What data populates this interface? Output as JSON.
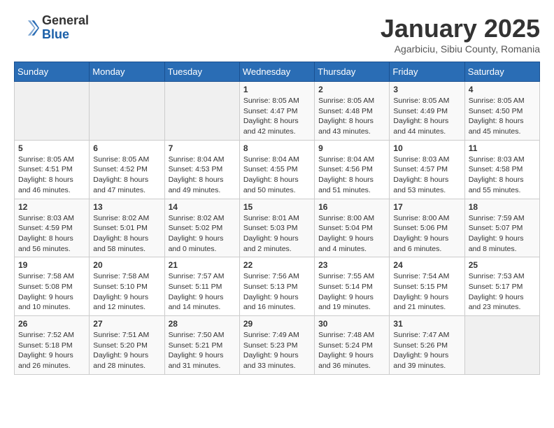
{
  "header": {
    "logo_general": "General",
    "logo_blue": "Blue",
    "month_title": "January 2025",
    "location": "Agarbiciu, Sibiu County, Romania"
  },
  "days_of_week": [
    "Sunday",
    "Monday",
    "Tuesday",
    "Wednesday",
    "Thursday",
    "Friday",
    "Saturday"
  ],
  "weeks": [
    [
      {
        "day": "",
        "info": ""
      },
      {
        "day": "",
        "info": ""
      },
      {
        "day": "",
        "info": ""
      },
      {
        "day": "1",
        "info": "Sunrise: 8:05 AM\nSunset: 4:47 PM\nDaylight: 8 hours and 42 minutes."
      },
      {
        "day": "2",
        "info": "Sunrise: 8:05 AM\nSunset: 4:48 PM\nDaylight: 8 hours and 43 minutes."
      },
      {
        "day": "3",
        "info": "Sunrise: 8:05 AM\nSunset: 4:49 PM\nDaylight: 8 hours and 44 minutes."
      },
      {
        "day": "4",
        "info": "Sunrise: 8:05 AM\nSunset: 4:50 PM\nDaylight: 8 hours and 45 minutes."
      }
    ],
    [
      {
        "day": "5",
        "info": "Sunrise: 8:05 AM\nSunset: 4:51 PM\nDaylight: 8 hours and 46 minutes."
      },
      {
        "day": "6",
        "info": "Sunrise: 8:05 AM\nSunset: 4:52 PM\nDaylight: 8 hours and 47 minutes."
      },
      {
        "day": "7",
        "info": "Sunrise: 8:04 AM\nSunset: 4:53 PM\nDaylight: 8 hours and 49 minutes."
      },
      {
        "day": "8",
        "info": "Sunrise: 8:04 AM\nSunset: 4:55 PM\nDaylight: 8 hours and 50 minutes."
      },
      {
        "day": "9",
        "info": "Sunrise: 8:04 AM\nSunset: 4:56 PM\nDaylight: 8 hours and 51 minutes."
      },
      {
        "day": "10",
        "info": "Sunrise: 8:03 AM\nSunset: 4:57 PM\nDaylight: 8 hours and 53 minutes."
      },
      {
        "day": "11",
        "info": "Sunrise: 8:03 AM\nSunset: 4:58 PM\nDaylight: 8 hours and 55 minutes."
      }
    ],
    [
      {
        "day": "12",
        "info": "Sunrise: 8:03 AM\nSunset: 4:59 PM\nDaylight: 8 hours and 56 minutes."
      },
      {
        "day": "13",
        "info": "Sunrise: 8:02 AM\nSunset: 5:01 PM\nDaylight: 8 hours and 58 minutes."
      },
      {
        "day": "14",
        "info": "Sunrise: 8:02 AM\nSunset: 5:02 PM\nDaylight: 9 hours and 0 minutes."
      },
      {
        "day": "15",
        "info": "Sunrise: 8:01 AM\nSunset: 5:03 PM\nDaylight: 9 hours and 2 minutes."
      },
      {
        "day": "16",
        "info": "Sunrise: 8:00 AM\nSunset: 5:04 PM\nDaylight: 9 hours and 4 minutes."
      },
      {
        "day": "17",
        "info": "Sunrise: 8:00 AM\nSunset: 5:06 PM\nDaylight: 9 hours and 6 minutes."
      },
      {
        "day": "18",
        "info": "Sunrise: 7:59 AM\nSunset: 5:07 PM\nDaylight: 9 hours and 8 minutes."
      }
    ],
    [
      {
        "day": "19",
        "info": "Sunrise: 7:58 AM\nSunset: 5:08 PM\nDaylight: 9 hours and 10 minutes."
      },
      {
        "day": "20",
        "info": "Sunrise: 7:58 AM\nSunset: 5:10 PM\nDaylight: 9 hours and 12 minutes."
      },
      {
        "day": "21",
        "info": "Sunrise: 7:57 AM\nSunset: 5:11 PM\nDaylight: 9 hours and 14 minutes."
      },
      {
        "day": "22",
        "info": "Sunrise: 7:56 AM\nSunset: 5:13 PM\nDaylight: 9 hours and 16 minutes."
      },
      {
        "day": "23",
        "info": "Sunrise: 7:55 AM\nSunset: 5:14 PM\nDaylight: 9 hours and 19 minutes."
      },
      {
        "day": "24",
        "info": "Sunrise: 7:54 AM\nSunset: 5:15 PM\nDaylight: 9 hours and 21 minutes."
      },
      {
        "day": "25",
        "info": "Sunrise: 7:53 AM\nSunset: 5:17 PM\nDaylight: 9 hours and 23 minutes."
      }
    ],
    [
      {
        "day": "26",
        "info": "Sunrise: 7:52 AM\nSunset: 5:18 PM\nDaylight: 9 hours and 26 minutes."
      },
      {
        "day": "27",
        "info": "Sunrise: 7:51 AM\nSunset: 5:20 PM\nDaylight: 9 hours and 28 minutes."
      },
      {
        "day": "28",
        "info": "Sunrise: 7:50 AM\nSunset: 5:21 PM\nDaylight: 9 hours and 31 minutes."
      },
      {
        "day": "29",
        "info": "Sunrise: 7:49 AM\nSunset: 5:23 PM\nDaylight: 9 hours and 33 minutes."
      },
      {
        "day": "30",
        "info": "Sunrise: 7:48 AM\nSunset: 5:24 PM\nDaylight: 9 hours and 36 minutes."
      },
      {
        "day": "31",
        "info": "Sunrise: 7:47 AM\nSunset: 5:26 PM\nDaylight: 9 hours and 39 minutes."
      },
      {
        "day": "",
        "info": ""
      }
    ]
  ]
}
